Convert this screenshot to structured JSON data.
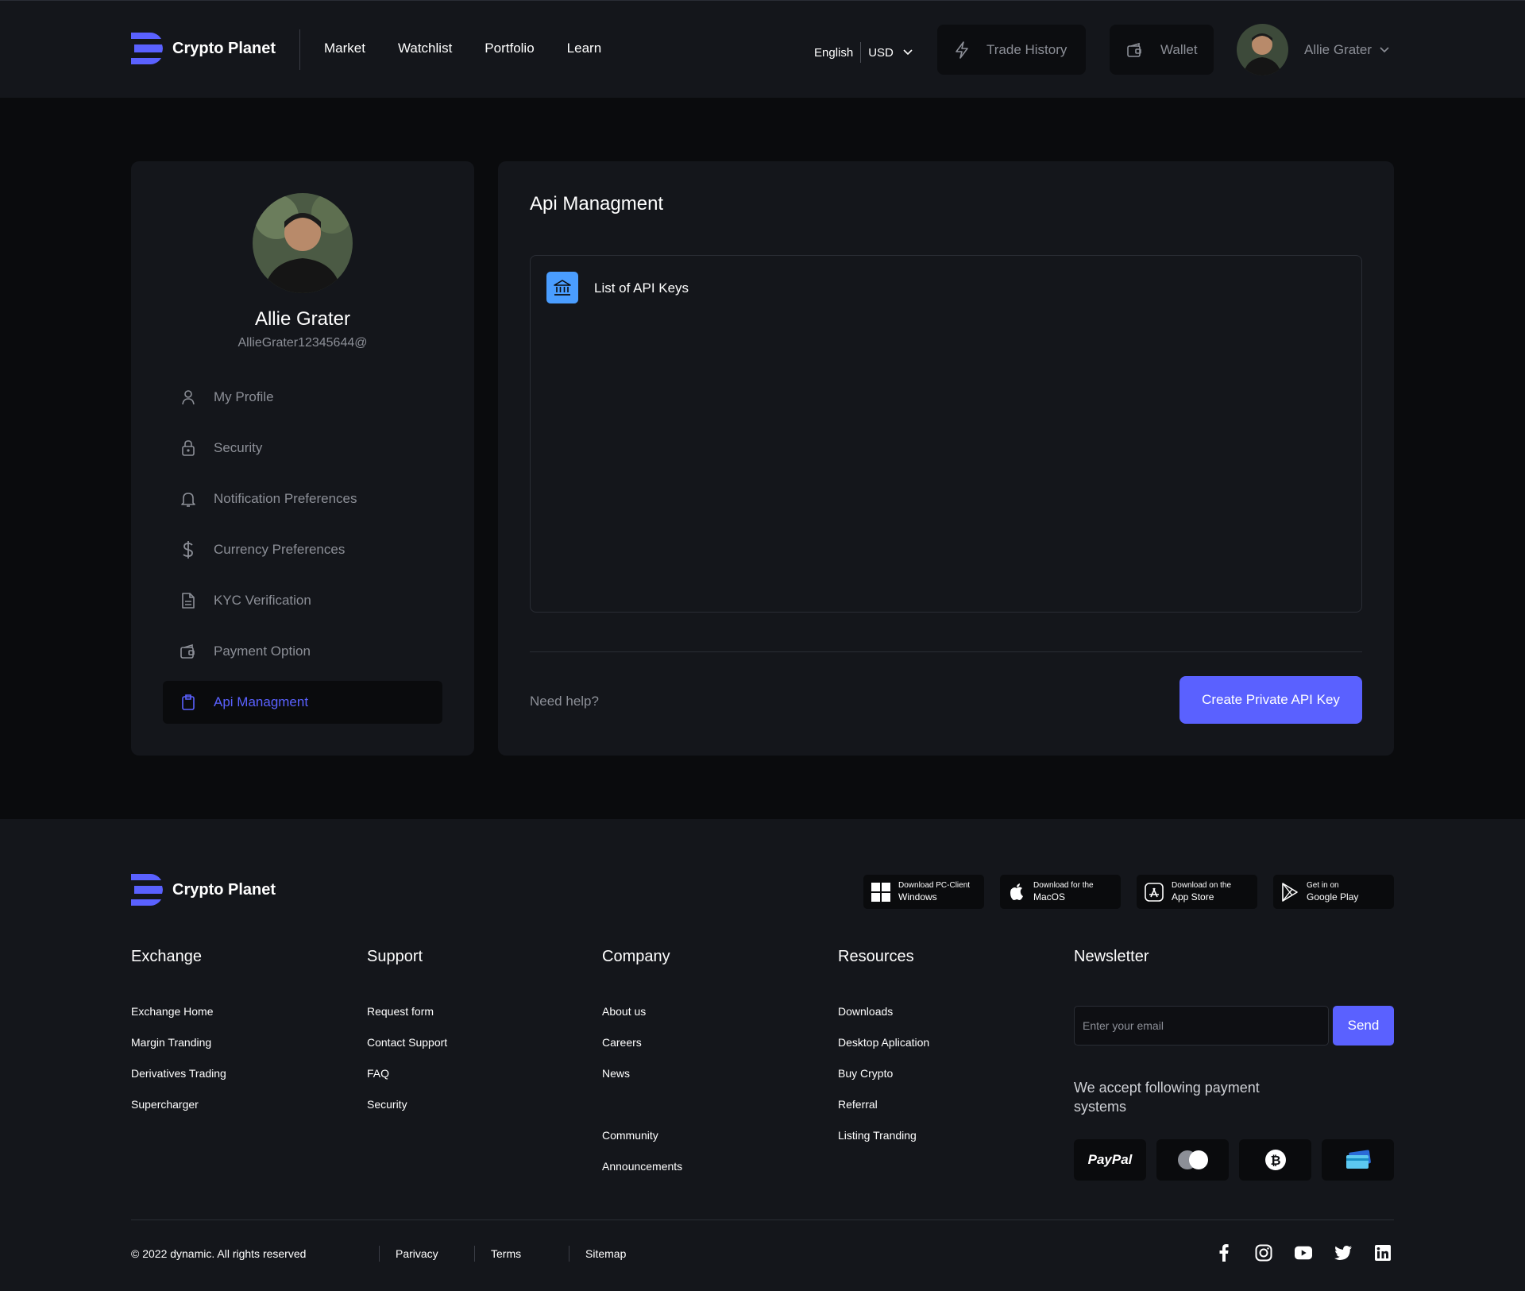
{
  "brand": {
    "name": "Crypto Planet",
    "accent": "#5a61ff"
  },
  "nav": {
    "items": [
      "Market",
      "Watchlist",
      "Portfolio",
      "Learn"
    ]
  },
  "header": {
    "language": "English",
    "currency": "USD",
    "trade_history": "Trade History",
    "wallet": "Wallet",
    "user_name": "Allie Grater"
  },
  "profile": {
    "name": "Allie Grater",
    "email": "AllieGrater12345644@"
  },
  "sidebar": {
    "items": [
      {
        "label": "My Profile",
        "icon": "user-icon"
      },
      {
        "label": "Security",
        "icon": "lock-icon"
      },
      {
        "label": "Notification Preferences",
        "icon": "bell-icon"
      },
      {
        "label": "Currency Preferences",
        "icon": "dollar-icon"
      },
      {
        "label": "KYC Verification",
        "icon": "document-icon"
      },
      {
        "label": "Payment Option",
        "icon": "wallet-icon"
      },
      {
        "label": "Api Managment",
        "icon": "clipboard-icon",
        "active": true
      }
    ]
  },
  "main": {
    "title": "Api Managment",
    "list_title": "List of API Keys",
    "need_help": "Need help?",
    "create_button": "Create Private API Key"
  },
  "footer": {
    "apps": [
      {
        "small": "Download PC-Client",
        "big": "Windows",
        "icon": "windows-icon"
      },
      {
        "small": "Download for the",
        "big": "MacOS",
        "icon": "apple-icon"
      },
      {
        "small": "Download on the",
        "big": "App Store",
        "icon": "app-store-icon"
      },
      {
        "small": "Get in on",
        "big": "Google Play",
        "icon": "google-play-icon"
      }
    ],
    "columns": {
      "exchange": {
        "title": "Exchange",
        "links": [
          "Exchange Home",
          "Margin Tranding",
          "Derivatives Trading",
          "Supercharger"
        ]
      },
      "support": {
        "title": "Support",
        "links": [
          "Request form",
          "Contact Support",
          "FAQ",
          "Security"
        ]
      },
      "company": {
        "title": "Company",
        "links": [
          "About us",
          "Careers",
          "News",
          "Community",
          "Announcements"
        ]
      },
      "resources": {
        "title": "Resources",
        "links": [
          "Downloads",
          "Desktop Aplication",
          "Buy Crypto",
          "Referral",
          "Listing Tranding"
        ]
      }
    },
    "newsletter": {
      "title": "Newsletter",
      "placeholder": "Enter your email",
      "send": "Send",
      "payment_title": "We accept following payment systems",
      "paypal": "PayPal"
    },
    "copyright": "© 2022 dynamic. All rights reserved",
    "legal": [
      "Parivacy",
      "Terms",
      "Sitemap"
    ],
    "socials": [
      "facebook-icon",
      "instagram-icon",
      "youtube-icon",
      "twitter-icon",
      "linkedin-icon"
    ]
  }
}
